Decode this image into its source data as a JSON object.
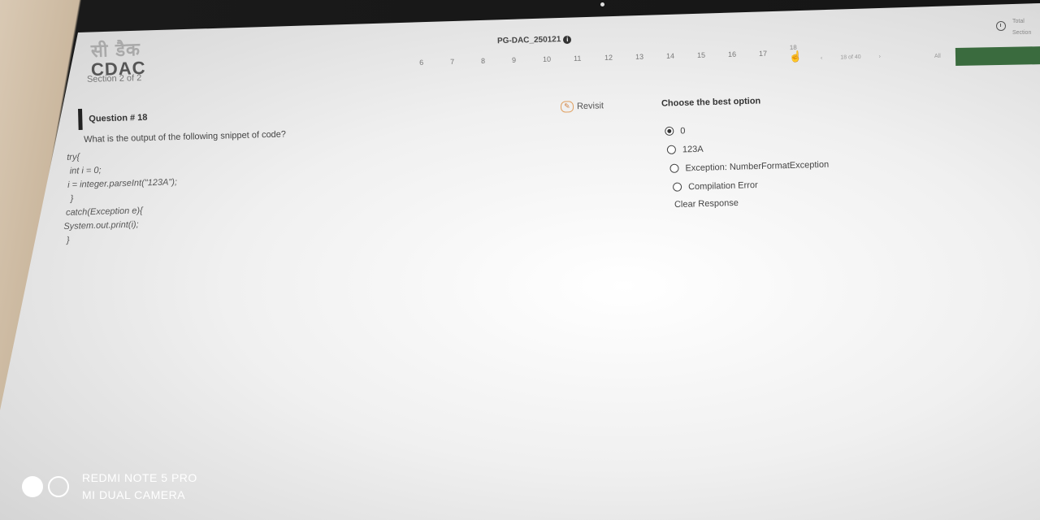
{
  "header": {
    "logo_hindi": "सी डैक",
    "logo_text": "CDAC",
    "section": "Section 2 of 2",
    "exam_title": "PG-DAC_250121",
    "timer_labels": [
      "Total",
      "Section"
    ]
  },
  "question_nav": {
    "numbers": [
      "6",
      "7",
      "8",
      "9",
      "10",
      "11",
      "12",
      "13",
      "14",
      "15",
      "16",
      "17",
      "18"
    ],
    "current": "18",
    "pager_text": "18 of 40",
    "filter": "All"
  },
  "question": {
    "title": "Question # 18",
    "revisit_label": "Revisit",
    "text": "What is the output of the following snippet of code?",
    "code_lines": [
      "  try{",
      "   int i = 0;",
      "  i = integer.parseInt(\"123A\");",
      "   }",
      " catch(Exception e){",
      "System.out.print(i);",
      " }"
    ]
  },
  "answers": {
    "prompt": "Choose the best option",
    "options": [
      "0",
      "123A",
      "Exception: NumberFormatException",
      "Compilation Error"
    ],
    "selected_index": 0,
    "clear_label": "Clear Response"
  },
  "watermark": {
    "line1": "REDMI NOTE 5 PRO",
    "line2": "MI DUAL CAMERA"
  }
}
